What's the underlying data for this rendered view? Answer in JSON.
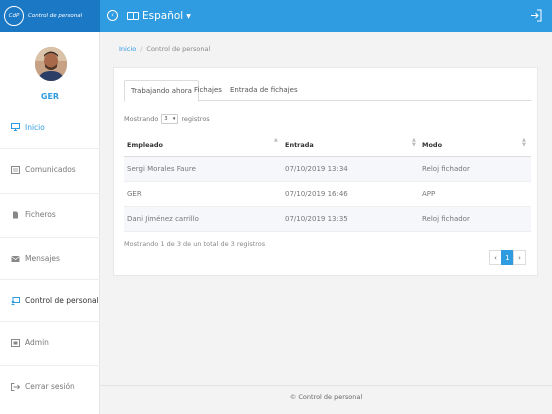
{
  "app": {
    "logo_text": "CdP",
    "brand": "Control de personal",
    "language": "Español"
  },
  "user": {
    "name": "GER"
  },
  "sidebar": {
    "items": [
      {
        "label": "Inicio",
        "icon": "monitor-icon"
      },
      {
        "label": "Comunicados",
        "icon": "newspaper-icon"
      },
      {
        "label": "Ficheros",
        "icon": "file-icon"
      },
      {
        "label": "Mensajes",
        "icon": "envelope-icon"
      },
      {
        "label": "Control de personal",
        "icon": "people-screen-icon"
      },
      {
        "label": "Admin",
        "icon": "admin-icon"
      },
      {
        "label": "Cerrar sesión",
        "icon": "sign-out-icon"
      }
    ]
  },
  "breadcrumb": {
    "home": "Inicio",
    "current": "Control de personal"
  },
  "tabs": [
    "Trabajando ahora",
    "Fichajes",
    "Entrada de fichajes"
  ],
  "length": {
    "prefix": "Mostrando",
    "value": "3",
    "suffix": "registros"
  },
  "table": {
    "headers": [
      "Empleado",
      "Entrada",
      "Modo"
    ],
    "rows": [
      [
        "Sergi Morales Faure",
        "07/10/2019 13:34",
        "Reloj fichador"
      ],
      [
        "GER",
        "07/10/2019 16:46",
        "APP"
      ],
      [
        "Dani Jiménez carrillo",
        "07/10/2019 13:35",
        "Reloj fichador"
      ]
    ]
  },
  "info": "Mostrando 1 de 3 de un total de 3 registros",
  "pagination": {
    "prev": "‹",
    "current": "1",
    "next": "›"
  },
  "footer": "© Control de personal",
  "colors": {
    "primary": "#2f9be0",
    "brand_dark": "#1b78c4"
  }
}
